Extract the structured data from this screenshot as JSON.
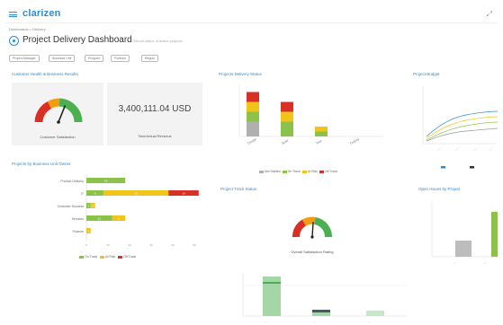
{
  "header": {
    "app_name": "clarizen",
    "top_right_icon": "expand-icon"
  },
  "breadcrumb": "Dashboards > Delivery",
  "title": {
    "text": "Project Delivery Dashboard",
    "subtitle": "Overall status of active projects"
  },
  "filters": [
    "Project Manager",
    "Business Unit",
    "Program",
    "Portfolio",
    "Region"
  ],
  "colors": {
    "accent": "#2d8bd6",
    "green": "#8bc34a",
    "yellow": "#f0c419",
    "orange": "#f39c12",
    "red": "#d93025",
    "gray": "#b0b0b0"
  },
  "cards": {
    "health_kpi": {
      "title": "Customer Health & Business Results",
      "gauge_label": "Customer Satisfaction",
      "gauge_value_fraction": 0.62,
      "amount": "3,400,111.04 USD",
      "amount_label": "Total Actual Revenue"
    },
    "delivery_status": {
      "title": "Projects Delivery Status",
      "legend": [
        "Not Started",
        "On Track",
        "At Risk",
        "Off Track"
      ]
    },
    "profitability": {
      "title": "Project Budget"
    },
    "resource_bars": {
      "title": "Projects by Business Unit Owner",
      "legend": [
        "On Track",
        "At Risk",
        "Off Track"
      ]
    },
    "project_health": {
      "title": "Project Track Status",
      "gauge_label": "Overall Satisfaction Rating",
      "gauge_value_fraction": 0.52
    },
    "risk": {
      "title": "Open Issues by Project"
    }
  },
  "chart_data": [
    {
      "type": "bar",
      "title": "Projects Delivery Status",
      "categories": [
        "Design",
        "Build",
        "Test",
        "Deploy"
      ],
      "series": [
        {
          "name": "Not Started",
          "values": [
            3,
            0,
            0,
            0
          ]
        },
        {
          "name": "On Track",
          "values": [
            2,
            3,
            1,
            0
          ]
        },
        {
          "name": "At Risk",
          "values": [
            2,
            2,
            1,
            0
          ]
        },
        {
          "name": "Off Track",
          "values": [
            2,
            2,
            0,
            0
          ]
        }
      ]
    },
    {
      "type": "bar",
      "title": "Projects by Business Unit Owner",
      "categories": [
        "Product Delivery",
        "IT",
        "Customer Success",
        "Services",
        "Finance"
      ],
      "series": [
        {
          "name": "On Track",
          "values": [
            18,
            8,
            2,
            12,
            0
          ]
        },
        {
          "name": "At Risk",
          "values": [
            0,
            30,
            2,
            6,
            2
          ]
        },
        {
          "name": "Off Track",
          "values": [
            0,
            14,
            0,
            0,
            0
          ]
        }
      ]
    }
  ]
}
